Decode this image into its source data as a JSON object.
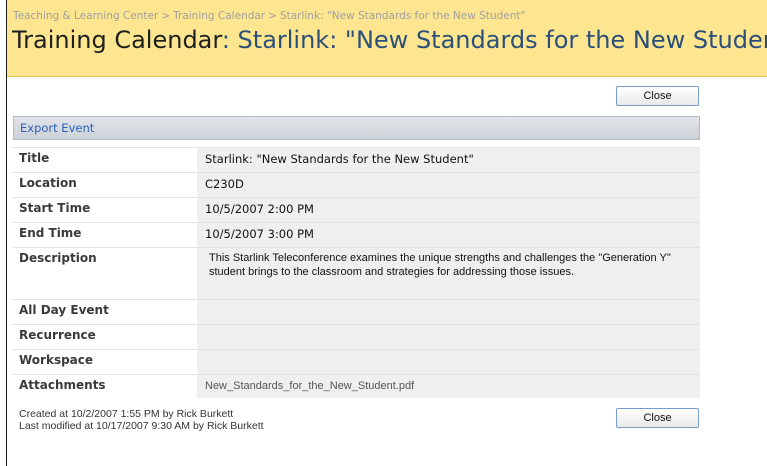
{
  "breadcrumb": {
    "items": [
      "Teaching & Learning Center",
      "Training Calendar",
      "Starlink: \"New Standards for the New Student\""
    ],
    "separator": ">"
  },
  "page_title": {
    "prefix": "Training Calendar",
    "rest": ": Starlink: \"New Standards for the New Student\""
  },
  "buttons": {
    "close_label": "Close"
  },
  "toolbar": {
    "export_label": "Export Event"
  },
  "fields": [
    {
      "label": "Title",
      "value": "Starlink: \"New Standards for the New Student\""
    },
    {
      "label": "Location",
      "value": "C230D"
    },
    {
      "label": "Start Time",
      "value": "10/5/2007 2:00 PM"
    },
    {
      "label": "End Time",
      "value": "10/5/2007 3:00 PM"
    },
    {
      "label": "Description",
      "value": "This Starlink Teleconference examines the unique strengths and challenges the \"Generation Y\" student brings to the classroom and strategies for addressing those issues."
    },
    {
      "label": "All Day Event",
      "value": ""
    },
    {
      "label": "Recurrence",
      "value": ""
    },
    {
      "label": "Workspace",
      "value": ""
    },
    {
      "label": "Attachments",
      "value": "New_Standards_for_the_New_Student.pdf"
    }
  ],
  "footer": {
    "created": "Created at 10/2/2007 1:55 PM  by Rick Burkett",
    "modified": "Last modified at 10/17/2007 9:30 AM  by Rick Burkett"
  },
  "colors": {
    "header_bg": "#fde68f",
    "link": "#2a5ebd",
    "value_bg": "#efefef"
  }
}
